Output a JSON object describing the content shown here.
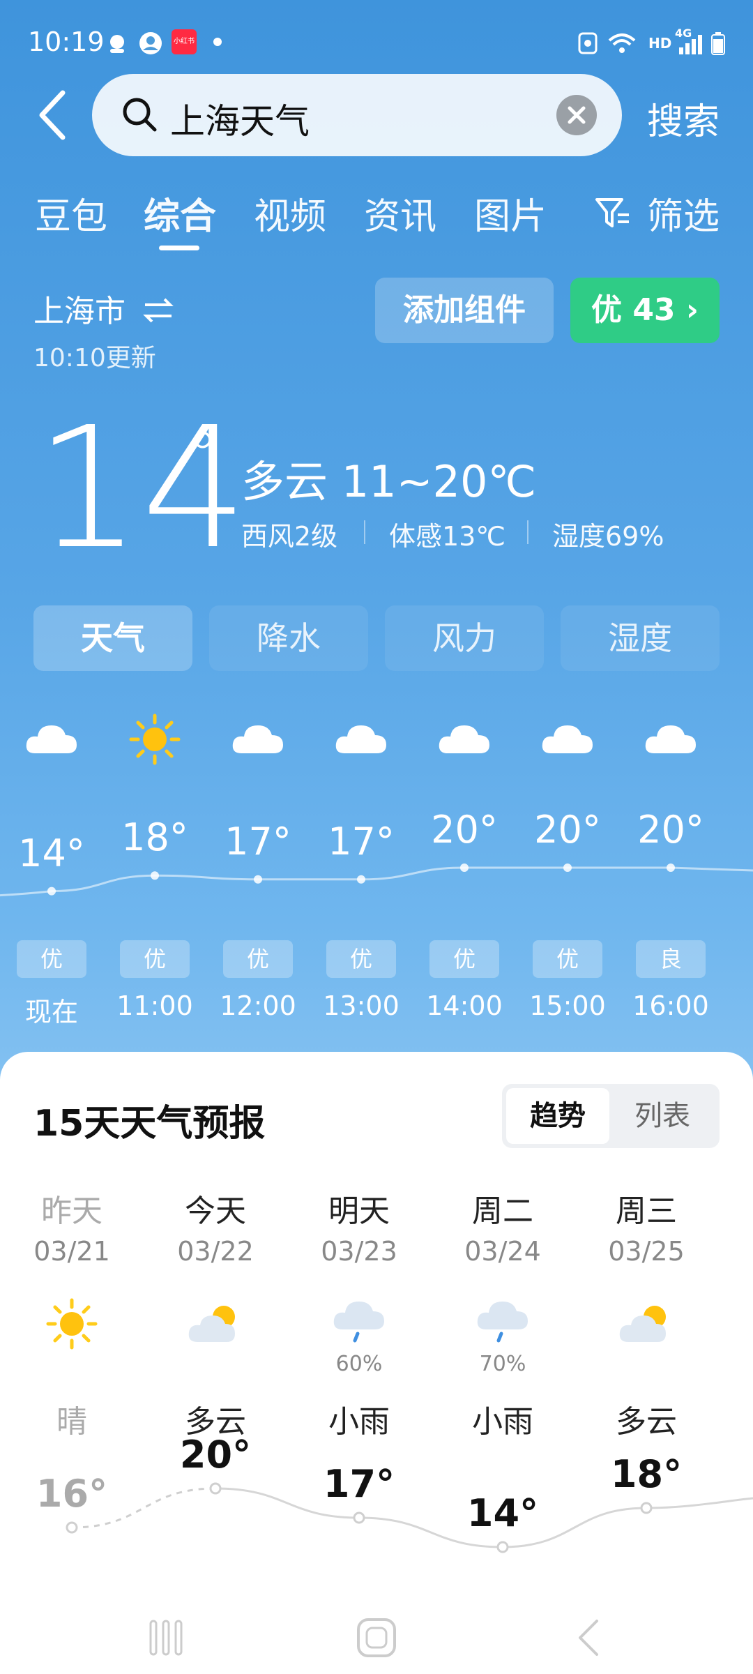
{
  "status_bar": {
    "time": "10:19",
    "network": "4G",
    "hd": "HD",
    "app_badge": "小红书"
  },
  "search": {
    "query": "上海天气",
    "button": "搜索"
  },
  "tabs": [
    {
      "label": "豆包"
    },
    {
      "label": "综合"
    },
    {
      "label": "视频"
    },
    {
      "label": "资讯"
    },
    {
      "label": "图片"
    },
    {
      "label": "筛选"
    }
  ],
  "location": {
    "city": "上海市",
    "updated": "10:10更新",
    "add_widget": "添加组件",
    "aqi": "优 43 ›"
  },
  "current": {
    "temperature": "14",
    "degree": "°",
    "condition": "多云  11~20℃",
    "wind": "西风2级",
    "feels_like": "体感13℃",
    "humidity": "湿度69%"
  },
  "metric_tabs": [
    {
      "label": "天气"
    },
    {
      "label": "降水"
    },
    {
      "label": "风力"
    },
    {
      "label": "湿度"
    }
  ],
  "hourly": [
    {
      "time": "现在",
      "temp": "14°",
      "aqi": "优",
      "icon": "cloud-icon"
    },
    {
      "time": "11:00",
      "temp": "18°",
      "aqi": "优",
      "icon": "sun-icon"
    },
    {
      "time": "12:00",
      "temp": "17°",
      "aqi": "优",
      "icon": "cloud-icon"
    },
    {
      "time": "13:00",
      "temp": "17°",
      "aqi": "优",
      "icon": "cloud-icon"
    },
    {
      "time": "14:00",
      "temp": "20°",
      "aqi": "优",
      "icon": "cloud-icon"
    },
    {
      "time": "15:00",
      "temp": "20°",
      "aqi": "优",
      "icon": "cloud-icon"
    },
    {
      "time": "16:00",
      "temp": "20°",
      "aqi": "良",
      "icon": "cloud-icon"
    }
  ],
  "forecast": {
    "title": "15天天气预报",
    "toggle": {
      "trend": "趋势",
      "list": "列表"
    },
    "days": [
      {
        "name": "昨天",
        "date": "03/21",
        "cond": "晴",
        "prob": "",
        "high": "16°",
        "icon": "sun-icon"
      },
      {
        "name": "今天",
        "date": "03/22",
        "cond": "多云",
        "prob": "",
        "high": "20°",
        "icon": "partly-cloudy-icon"
      },
      {
        "name": "明天",
        "date": "03/23",
        "cond": "小雨",
        "prob": "60%",
        "high": "17°",
        "icon": "rain-icon"
      },
      {
        "name": "周二",
        "date": "03/24",
        "cond": "小雨",
        "prob": "70%",
        "high": "14°",
        "icon": "rain-icon"
      },
      {
        "name": "周三",
        "date": "03/25",
        "cond": "多云",
        "prob": "",
        "high": "18°",
        "icon": "partly-cloudy-icon"
      }
    ]
  }
}
